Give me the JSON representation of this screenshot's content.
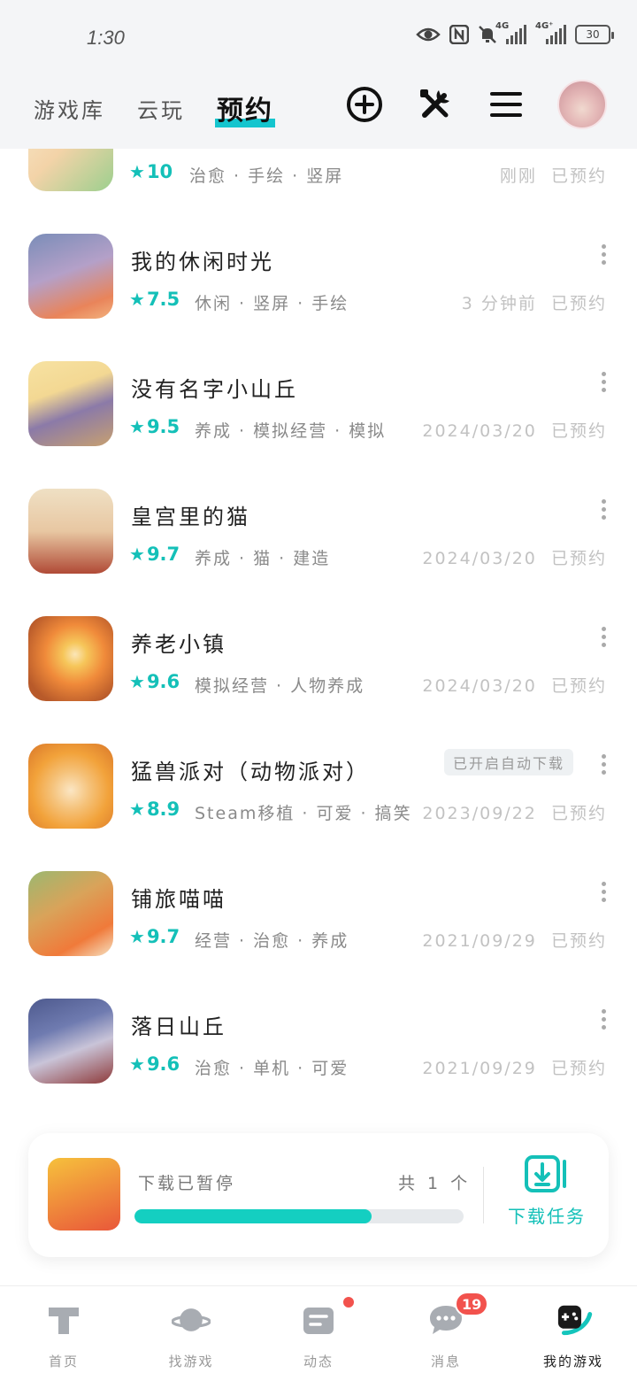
{
  "status_bar": {
    "time": "1:30",
    "battery": "30",
    "net1": "4G",
    "net2": "4G⁺"
  },
  "header": {
    "tabs": [
      {
        "label": "游戏库"
      },
      {
        "label": "云玩"
      },
      {
        "label": "预约"
      }
    ],
    "actions": [
      "add-icon",
      "tools-icon",
      "menu-icon",
      "avatar"
    ]
  },
  "games": [
    {
      "name": "",
      "rating": "10",
      "tags": "治愈 · 手绘 · 竖屏",
      "time": "刚刚",
      "status": "已预约",
      "colors": [
        "#f6e7c8",
        "#9ccf8e"
      ]
    },
    {
      "name": "我的休闲时光",
      "rating": "7.5",
      "tags": "休闲 · 竖屏 · 手绘",
      "time": "3 分钟前",
      "status": "已预约",
      "colors": [
        "#b4a0c8",
        "#e9845a"
      ]
    },
    {
      "name": "没有名字小山丘",
      "rating": "9.5",
      "tags": "养成 · 模拟经营 · 模拟",
      "time": "2024/03/20",
      "status": "已预约",
      "colors": [
        "#f3d893",
        "#8b7aa8"
      ]
    },
    {
      "name": "皇宫里的猫",
      "rating": "9.7",
      "tags": "养成 · 猫 · 建造",
      "time": "2024/03/20",
      "status": "已预约",
      "colors": [
        "#efe0c4",
        "#b04a36"
      ]
    },
    {
      "name": "养老小镇",
      "rating": "9.6",
      "tags": "模拟经营 · 人物养成",
      "time": "2024/03/20",
      "status": "已预约",
      "colors": [
        "#f08a3a",
        "#f6c65a"
      ]
    },
    {
      "name": "猛兽派对（动物派对）",
      "rating": "8.9",
      "tags": "Steam移植 · 可爱 · 搞笑",
      "time": "2023/09/22",
      "status": "已预约",
      "colors": [
        "#f2a23a",
        "#fbe6c4"
      ],
      "badge": "已开启自动下载"
    },
    {
      "name": "铺旅喵喵",
      "rating": "9.7",
      "tags": "经营 · 治愈 · 养成",
      "time": "2021/09/29",
      "status": "已预约",
      "colors": [
        "#d9a35a",
        "#f07a3a"
      ]
    },
    {
      "name": "落日山丘",
      "rating": "9.6",
      "tags": "治愈 · 单机 · 可爱",
      "time": "2021/09/29",
      "status": "已预约",
      "colors": [
        "#6f7bb0",
        "#c9c4d8"
      ]
    }
  ],
  "download": {
    "status": "下载已暂停",
    "count": "共 1 个",
    "progress": 0.72,
    "task_label": "下载任务"
  },
  "bottom_nav": [
    {
      "label": "首页"
    },
    {
      "label": "找游戏"
    },
    {
      "label": "动态"
    },
    {
      "label": "消息",
      "badge": "19"
    },
    {
      "label": "我的游戏"
    }
  ]
}
